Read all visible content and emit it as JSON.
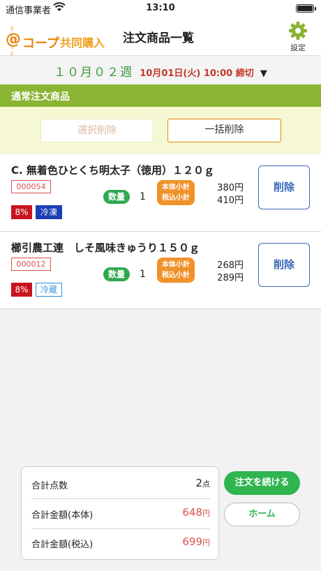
{
  "status_bar": {
    "carrier": "通信事業者",
    "time": "13:10"
  },
  "header": {
    "logo_small": "きょうっと",
    "logo_at": "@",
    "logo_coop": "コープ",
    "logo_kyodo": "共同購入",
    "title": "注文商品一覧",
    "settings_label": "設定",
    "accent_color": "#e8850c"
  },
  "week": {
    "week_label": "１０月０２週",
    "deadline": "10月01日(火) 10:00 締切",
    "dropdown_glyph": "▼"
  },
  "section": {
    "title": "通常注文商品",
    "color": "#8bb334"
  },
  "actions": {
    "select_delete": "選択削除",
    "bulk_delete": "一括削除"
  },
  "items": [
    {
      "name": "C.  無着色ひとくち明太子（徳用）１２０ｇ",
      "code": "000054",
      "tax": "8%",
      "temperature": "冷凍",
      "qty_label": "数量",
      "qty": "1",
      "subtotal_base_label": "本体小計",
      "subtotal_tax_label": "税込小計",
      "price_base": "380円",
      "price_tax": "410円",
      "delete": "削除"
    },
    {
      "name": "櫛引農工連　しそ風味きゅうり１５０ｇ",
      "code": "000012",
      "tax": "8%",
      "temperature": "冷蔵",
      "qty_label": "数量",
      "qty": "1",
      "subtotal_base_label": "本体小計",
      "subtotal_tax_label": "税込小計",
      "price_base": "268円",
      "price_tax": "289円",
      "delete": "削除"
    }
  ],
  "summary": {
    "count_label": "合計点数",
    "count_value": "2",
    "count_unit": "点",
    "base_label": "合計金額(本体)",
    "base_value": "648",
    "tax_label": "合計金額(税込)",
    "tax_value": "699",
    "yen_unit": "円"
  },
  "buttons": {
    "continue": "注文を続ける",
    "home": "ホーム"
  }
}
